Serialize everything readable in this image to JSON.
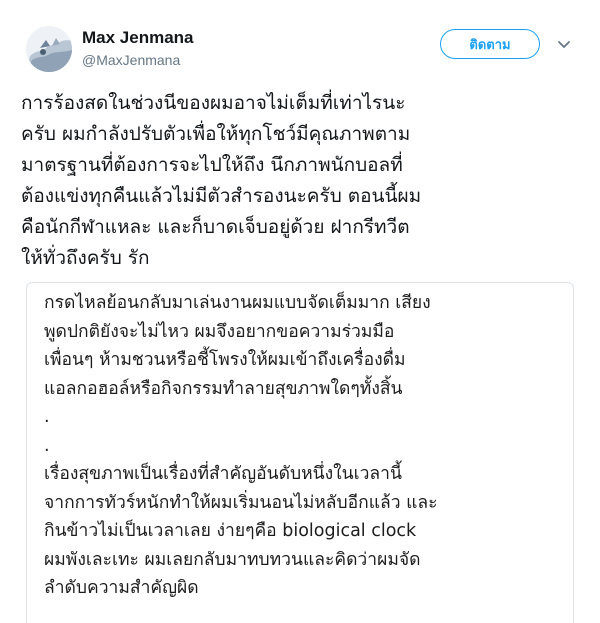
{
  "author": {
    "name": "Max Jenmana",
    "handle": "@MaxJenmana",
    "avatar_icon": "avatar-icon"
  },
  "follow_button": {
    "label": "ติดตาม"
  },
  "menu_icon": "chevron-down-icon",
  "colors": {
    "accent": "#1da1f2",
    "text": "#14171a",
    "muted": "#657786"
  },
  "tweet": {
    "lines": [
      "การร้องสดในช่วงนีของผมอาจไม่เต็มที่เท่าไรนะ",
      "ครับ ผมกำลังปรับตัวเพื่อให้ทุกโชว์มีคุณภาพตาม",
      "มาตรฐานที่ต้องการจะไปให้ถึง นึกภาพนักบอลที่",
      "ต้องแข่งทุกคืนแล้วไม่มีตัวสำรองนะครับ ตอนนี้ผม",
      "คือนักกีฬาแหละ และก็บาดเจ็บอยู่ด้วย ฝากรีทวีต",
      "ให้ทั่วถึงครับ รัก"
    ]
  },
  "media": {
    "lines": [
      "กรดไหลย้อนกลับมาเล่นงานผมแบบจัดเต็มมาก เสียง",
      "พูดปกติยังจะไม่ไหว ผมจึงอยากขอความร่วมมือ",
      "เพื่อนๆ ห้ามชวนหรือชี้โพรงให้ผมเข้าถึงเครื่องดื่ม",
      "แอลกอฮอล์หรือกิจกรรมทำลายสุขภาพใดๆทั้งสิ้น",
      ".",
      ".",
      "เรื่องสุขภาพเป็นเรื่องที่สำคัญอันดับหนึ่งในเวลานี้",
      "จากการทัวร์หนักทำให้ผมเริ่มนอนไม่หลับอีกแล้ว และ",
      "กินข้าวไม่เป็นเวลาเลย ง่ายๆคือ biological clock",
      "ผมพังเละเทะ ผมเลยกลับมาทบทวนและคิดว่าผมจัด",
      "ลำดับความสำคัญผิด"
    ]
  }
}
